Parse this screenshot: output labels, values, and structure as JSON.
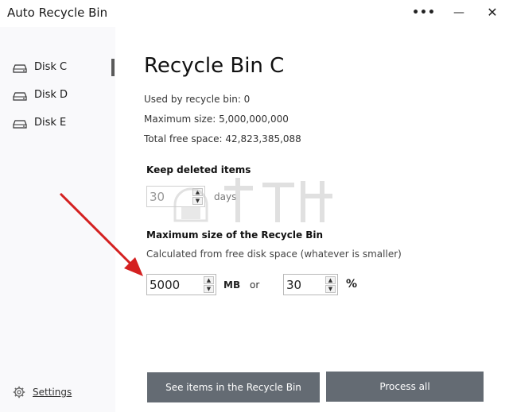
{
  "window": {
    "title": "Auto Recycle Bin",
    "more_label": "•••",
    "minimize_label": "—",
    "close_label": "✕"
  },
  "sidebar": {
    "items": [
      {
        "label": "Disk C",
        "icon": "disk-icon",
        "active": true
      },
      {
        "label": "Disk D",
        "icon": "disk-icon",
        "active": false
      },
      {
        "label": "Disk E",
        "icon": "disk-icon",
        "active": false
      }
    ],
    "settings": {
      "label": "Settings",
      "icon": "gear-icon"
    }
  },
  "main": {
    "title": "Recycle Bin C",
    "stats": {
      "used": "Used by recycle bin: 0",
      "max": "Maximum size: 5,000,000,000",
      "free": "Total free space: 42,823,385,088"
    },
    "keep": {
      "title": "Keep deleted items",
      "value": "30",
      "unit": "days"
    },
    "max_size": {
      "title": "Maximum size of the Recycle Bin",
      "subtitle": "Calculated from free disk space (whatever is smaller)",
      "mb_value": "5000",
      "mb_unit": "MB",
      "or_label": "or",
      "pct_value": "30",
      "pct_unit": "%"
    },
    "buttons": {
      "see_items": "See items in the Recycle Bin",
      "process_all": "Process all"
    }
  },
  "colors": {
    "button_bg": "#646b73",
    "sidebar_bg": "#f9f9fb",
    "active_indicator": "#5a5a5a",
    "annotation_arrow": "#d42020"
  }
}
